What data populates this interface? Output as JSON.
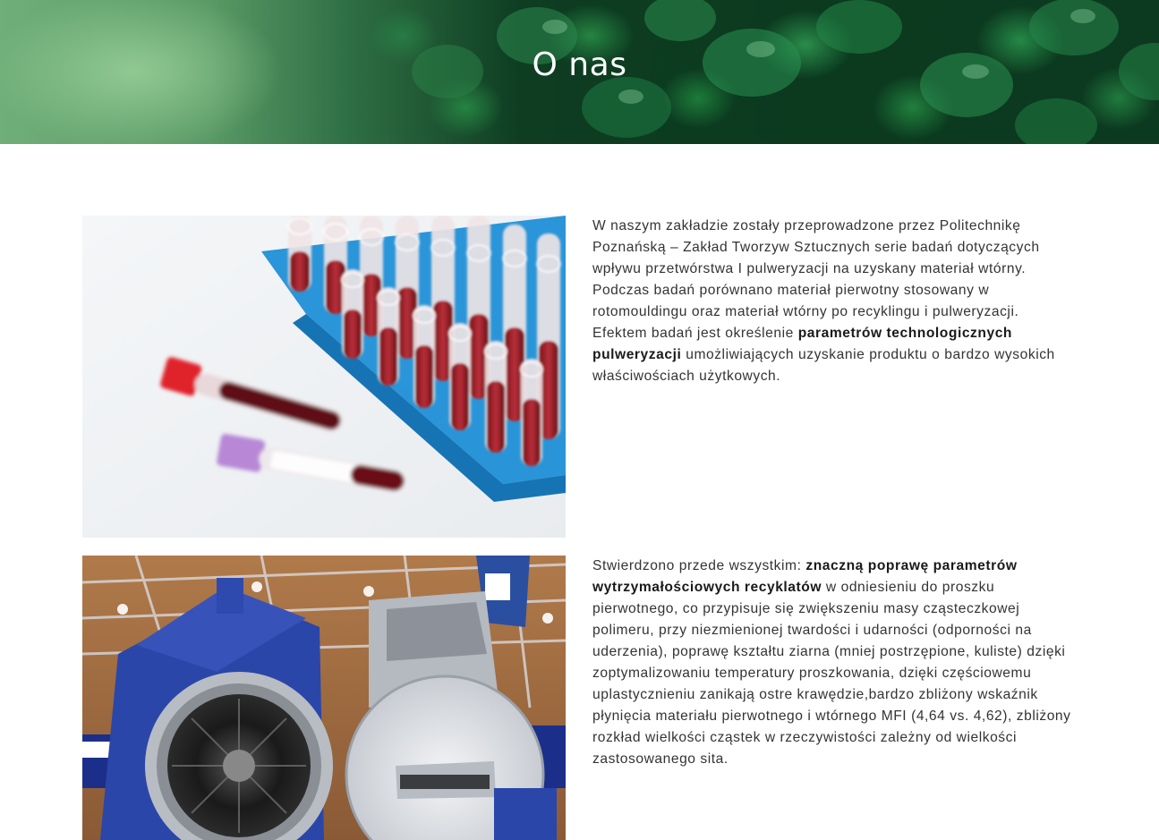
{
  "hero": {
    "title": "O nas"
  },
  "sections": [
    {
      "image": {
        "subject": "test-tubes-photo"
      },
      "paragraph": {
        "text_before": "W naszym zakładzie zostały przeprowadzone przez Politechnikę Poznańską – Zakład Tworzyw Sztucznych serie badań dotyczących wpływu przetwórstwa I pulweryzacji na uzyskany materiał wtórny. Podczas badań porównano materiał pierwotny stosowany w rotomouldingu oraz materiał wtórny po recyklingu i pulweryzacji. Efektem badań jest określenie ",
        "bold": "parametrów technologicznych pulweryzacji",
        "text_after": " umożliwiających uzyskanie produktu o bardzo wysokich właściwościach użytkowych."
      }
    },
    {
      "image": {
        "subject": "pulverizer-machine-photo"
      },
      "paragraph": {
        "text_before": "Stwierdzono przede wszystkim: ",
        "bold": "znaczną poprawę parametrów wytrzymałościowych recyklatów",
        "text_after": " w odniesieniu do proszku pierwotnego, co przypisuje się zwiększeniu masy cząsteczkowej polimeru, przy niezmienionej twardości i udarności (odporności na uderzenia), poprawę kształtu ziarna (mniej postrzępione, kuliste) dzięki zoptymalizowaniu temperatury proszkowania, dzięki częściowemu uplastycznieniu zanikają ostre krawędzie,bardzo zbliżony wskaźnik płynięcia materiału pierwotnego i wtórnego MFI (4,64 vs. 4,62), zbliżony rozkład wielkości cząstek w rzeczywistości zależny od wielkości zastosowanego sita."
      }
    }
  ],
  "colors": {
    "text": "#333333",
    "heading": "#ffffff",
    "tube_blood": "#8b1a1a",
    "rack_blue": "#1f8fd6",
    "machine_blue": "#243a9a"
  }
}
